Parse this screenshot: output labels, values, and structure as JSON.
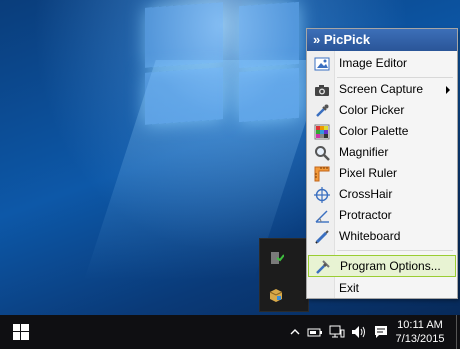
{
  "menu": {
    "title": "» PicPick",
    "items": [
      {
        "label": "Image Editor",
        "icon": "image-editor-icon"
      },
      {
        "label": "Screen Capture",
        "icon": "camera-icon",
        "submenu": true
      },
      {
        "label": "Color Picker",
        "icon": "eyedropper-icon"
      },
      {
        "label": "Color Palette",
        "icon": "palette-icon"
      },
      {
        "label": "Magnifier",
        "icon": "magnifier-icon"
      },
      {
        "label": "Pixel Ruler",
        "icon": "ruler-icon"
      },
      {
        "label": "CrossHair",
        "icon": "crosshair-icon"
      },
      {
        "label": "Protractor",
        "icon": "protractor-icon"
      },
      {
        "label": "Whiteboard",
        "icon": "whiteboard-pen-icon"
      },
      {
        "label": "Program Options...",
        "icon": "wrench-icon",
        "highlighted": true
      },
      {
        "label": "Exit",
        "icon": ""
      }
    ]
  },
  "taskbar": {
    "time": "10:11 AM",
    "date": "7/13/2015",
    "tray_icons": [
      "chevron-up-icon",
      "battery-icon",
      "network-icon",
      "volume-icon",
      "action-center-icon"
    ]
  },
  "colors": {
    "menu_header": "#2a5598",
    "highlight_border": "#9acd32",
    "taskbar": "#0f0f12"
  }
}
